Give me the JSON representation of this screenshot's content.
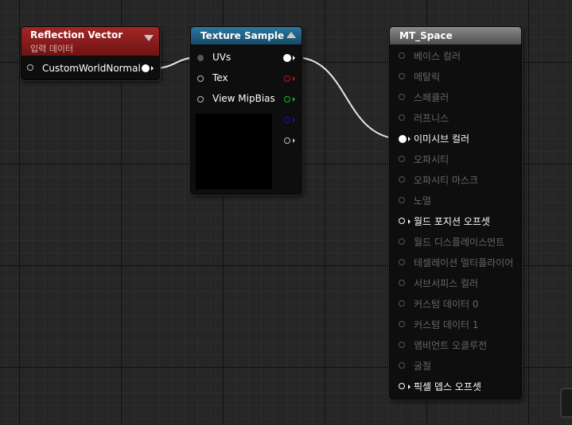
{
  "reflection_node": {
    "title": "Reflection Vector",
    "subtitle": "입력 데이터",
    "header_color": "#8a1c1c",
    "output_label": "CustomWorldNormal"
  },
  "texture_node": {
    "title": "Texture Sample",
    "header_color": "#1e5a7a",
    "inputs": [
      "UVs",
      "Tex",
      "View MipBias"
    ],
    "output_colors": [
      "#ffffff",
      "#d01010",
      "#10c010",
      "#1010d0",
      "#bcbcbc"
    ]
  },
  "material_node": {
    "title": "MT_Space",
    "header_color": "#6a6a6a",
    "inputs": [
      {
        "label": "베이스 컬러",
        "active": false
      },
      {
        "label": "메탈릭",
        "active": false
      },
      {
        "label": "스페큘러",
        "active": false
      },
      {
        "label": "러프니스",
        "active": false
      },
      {
        "label": "이미시브 컬러",
        "active": true
      },
      {
        "label": "오파시티",
        "active": false
      },
      {
        "label": "오파시티 마스크",
        "active": false
      },
      {
        "label": "노멀",
        "active": false
      },
      {
        "label": "월드 포지션 오프셋",
        "active": true
      },
      {
        "label": "월드 디스플레이스먼트",
        "active": false
      },
      {
        "label": "테셀레이션 멀티플라이어",
        "active": false
      },
      {
        "label": "서브서피스 컬러",
        "active": false
      },
      {
        "label": "커스텀 데이터 0",
        "active": false
      },
      {
        "label": "커스텀 데이터 1",
        "active": false
      },
      {
        "label": "앰비언트 오클루전",
        "active": false
      },
      {
        "label": "굴절",
        "active": false
      },
      {
        "label": "픽셀 뎁스 오프셋",
        "active": true
      }
    ]
  }
}
